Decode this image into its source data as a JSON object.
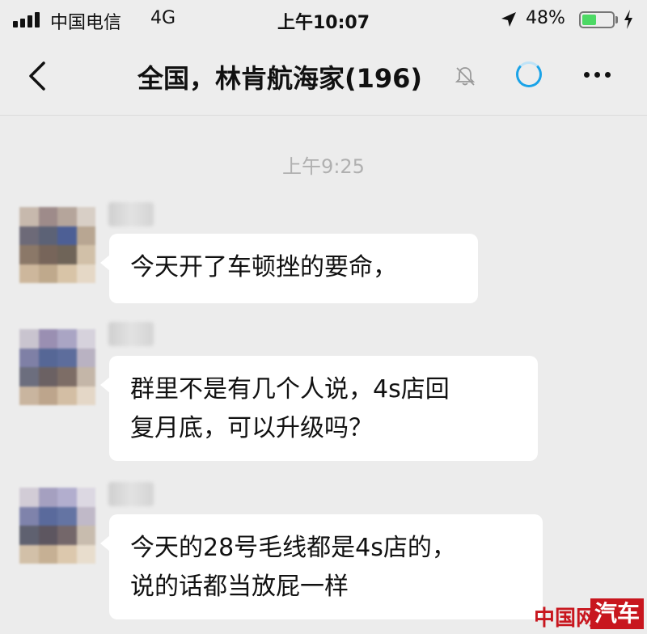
{
  "status_bar": {
    "carrier": "中国电信",
    "network": "4G",
    "time": "上午10:07",
    "battery_percent": "48%",
    "battery_level": 0.48
  },
  "nav": {
    "title": "全国，林肯航海家(196)",
    "back_icon": "chevron-left-icon",
    "mute_icon": "bell-muted-icon",
    "more_icon": "ellipsis-icon"
  },
  "chat": {
    "timestamp": "上午9:25",
    "messages": [
      {
        "lines": [
          "今天开了车顿挫的要命，"
        ]
      },
      {
        "lines": [
          "群里不是有几个人说，4s店回",
          "复月底，可以升级吗？"
        ]
      },
      {
        "lines": [
          "今天的28号毛线都是4s店的，",
          "说的话都当放屁一样"
        ]
      }
    ]
  },
  "watermark": {
    "brand": "中国网",
    "site": "汽车"
  },
  "colors": {
    "background": "#ececec",
    "bubble": "#ffffff",
    "accent": "#1aa3e8",
    "battery": "#4cd964"
  }
}
